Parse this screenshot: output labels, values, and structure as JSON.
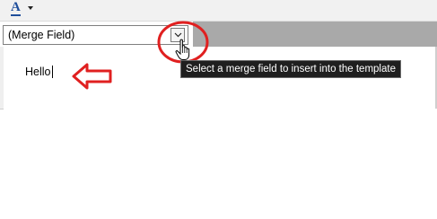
{
  "toolbar": {
    "font_color_glyph": "A",
    "font_color_icon": "font-color-icon",
    "dropdown_icon": "chevron-down-icon"
  },
  "merge_field": {
    "selected": "(Merge Field)",
    "dropdown_icon": "chevron-down-icon"
  },
  "tooltip": {
    "text": "Select a merge field to insert into the template"
  },
  "editor": {
    "text": "Hello"
  },
  "annotations": {
    "circle_color": "#e02020",
    "arrow_color": "#e02020"
  },
  "colors": {
    "toolbar_gray": "#a9a9a9",
    "tooltip_bg": "#1f1f1f",
    "font_color_accent": "#1f4e9b"
  }
}
